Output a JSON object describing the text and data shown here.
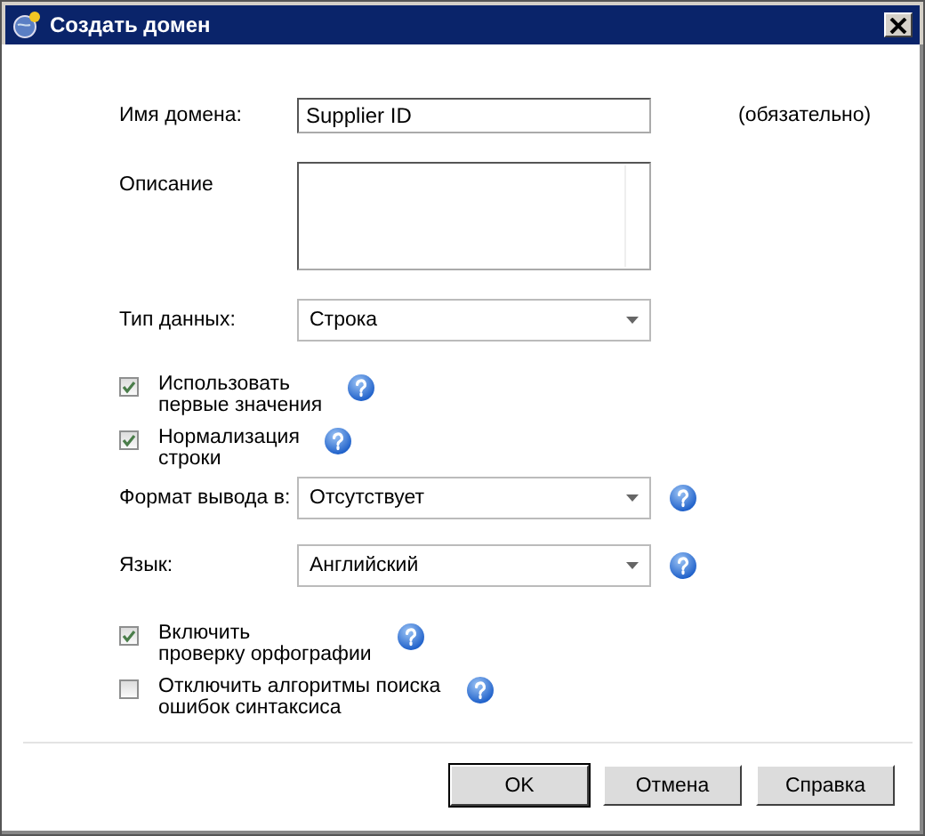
{
  "window": {
    "title": "Создать домен"
  },
  "rows": [
    {
      "kind": "text",
      "label": "Имя домена:",
      "value": "Supplier ID",
      "note": "(обязательно)",
      "help": false
    },
    {
      "kind": "textarea",
      "label": "Описание",
      "help": false
    },
    {
      "kind": "select",
      "label": "Тип данных:",
      "value": "Строка",
      "help": false
    },
    {
      "kind": "checkbox",
      "label": "Использовать\nпервые значения",
      "checked": true,
      "help": true
    },
    {
      "kind": "checkbox",
      "label": "Нормализация\nстроки",
      "checked": true,
      "help": true
    },
    {
      "kind": "select",
      "label": "Формат вывода в:",
      "value": "Отсутствует",
      "help": true
    },
    {
      "kind": "select",
      "label": "Язык:",
      "value": "Английский",
      "help": true
    },
    {
      "kind": "checkbox",
      "label": "Включить\nпроверку орфографии",
      "checked": true,
      "help": true
    },
    {
      "kind": "checkbox",
      "label": "Отключить алгоритмы поиска\nошибок синтаксиса",
      "checked": false,
      "help": true
    }
  ],
  "buttons": [
    {
      "label": "OK",
      "default": true
    },
    {
      "label": "Отмена",
      "default": false
    },
    {
      "label": "Справка",
      "default": false
    }
  ]
}
